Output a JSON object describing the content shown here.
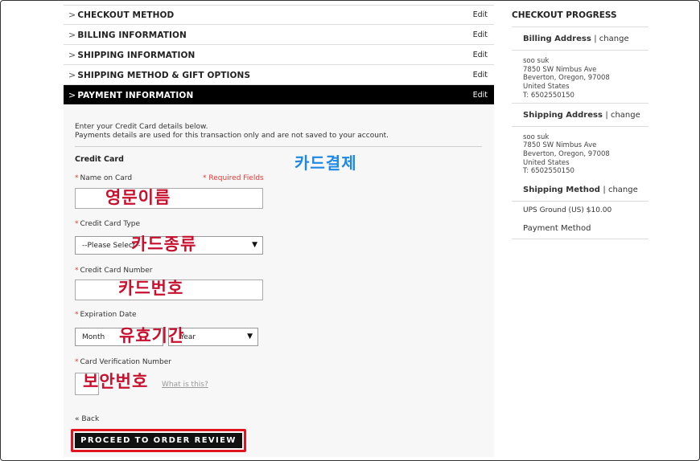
{
  "steps": [
    {
      "title": "CHECKOUT METHOD",
      "edit": "Edit"
    },
    {
      "title": "BILLING INFORMATION",
      "edit": "Edit"
    },
    {
      "title": "SHIPPING INFORMATION",
      "edit": "Edit"
    },
    {
      "title": "SHIPPING METHOD & GIFT OPTIONS",
      "edit": "Edit"
    },
    {
      "title": "PAYMENT INFORMATION",
      "edit": "Edit"
    }
  ],
  "payment": {
    "intro_line1": "Enter your Credit Card details below.",
    "intro_line2": "Payments details are used for this transaction only and are not saved to your account.",
    "section_title": "Credit Card",
    "required_note": "* Required Fields",
    "name_label": "Name on Card",
    "type_label": "Credit Card Type",
    "type_value": "--Please Select--",
    "number_label": "Credit Card Number",
    "expiry_label": "Expiration Date",
    "month_value": "Month",
    "year_value": "Year",
    "cvv_label": "Card Verification Number",
    "what_is_this": "What is this?",
    "back": "« Back",
    "proceed": "PROCEED TO ORDER REVIEW"
  },
  "annotations": {
    "card_payment": "카드결제",
    "english_name": "영문이름",
    "card_type": "카드종류",
    "card_number": "카드번호",
    "expiry": "유효기간",
    "security_code": "보안번호"
  },
  "progress": {
    "heading": "CHECKOUT PROGRESS",
    "billing_title": "Billing Address",
    "billing_change": "| change",
    "billing_lines": [
      "soo suk",
      "7850 SW Nimbus Ave",
      "Beverton, Oregon, 97008",
      "United States",
      "T: 6502550150"
    ],
    "shipping_title": "Shipping Address",
    "shipping_change": "| change",
    "shipping_lines": [
      "soo suk",
      "7850 SW Nimbus Ave",
      "Beverton, Oregon, 97008",
      "United States",
      "T: 6502550150"
    ],
    "method_title": "Shipping Method",
    "method_change": "| change",
    "method_value": "UPS Ground (US) $10.00",
    "payment_method": "Payment Method"
  },
  "colors": {
    "accent_red": "#e0141e",
    "required_red": "#e53935",
    "annotation_red": "#c8102e",
    "annotation_blue": "#1e88e5",
    "active_step_bg": "#000000"
  }
}
